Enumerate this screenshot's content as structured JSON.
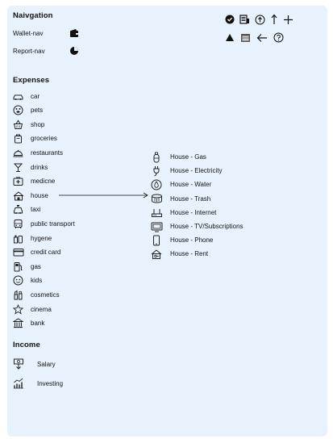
{
  "navigation": {
    "title": "Naivgation",
    "items": [
      {
        "label": "Wallet-nav",
        "icon": "wallet-icon"
      },
      {
        "label": "Report-nav",
        "icon": "pie-chart-icon"
      }
    ]
  },
  "toolbar": {
    "row1": [
      "check-circle-icon",
      "receipt-icon",
      "upload-circle-icon",
      "arrow-up-icon",
      "plus-icon"
    ],
    "row2": [
      "triangle-icon",
      "calendar-icon",
      "arrow-left-icon",
      "help-circle-icon"
    ]
  },
  "expenses": {
    "title": "Expenses",
    "items": [
      {
        "label": "car",
        "icon": "car-icon"
      },
      {
        "label": "pets",
        "icon": "paw-icon"
      },
      {
        "label": "shop",
        "icon": "basket-icon"
      },
      {
        "label": "groceries",
        "icon": "grocery-bag-icon"
      },
      {
        "label": "restaurants",
        "icon": "cloche-icon"
      },
      {
        "label": "drinks",
        "icon": "cocktail-icon"
      },
      {
        "label": "medicne",
        "icon": "medical-kit-icon"
      },
      {
        "label": "house",
        "icon": "house-icon"
      },
      {
        "label": "taxi",
        "icon": "taxi-icon"
      },
      {
        "label": "public transport",
        "icon": "bus-icon"
      },
      {
        "label": "hygene",
        "icon": "toiletries-icon"
      },
      {
        "label": "credit card",
        "icon": "credit-card-icon"
      },
      {
        "label": "gas",
        "icon": "fuel-icon"
      },
      {
        "label": "kids",
        "icon": "child-icon"
      },
      {
        "label": "cosmetics",
        "icon": "lipstick-icon"
      },
      {
        "label": "cinema",
        "icon": "star-icon"
      },
      {
        "label": "bank",
        "icon": "bank-icon"
      }
    ]
  },
  "house_subcategories": {
    "items": [
      {
        "label": "House - Gas",
        "icon": "gas-cylinder-icon"
      },
      {
        "label": "House - Electricity",
        "icon": "plug-icon"
      },
      {
        "label": "House - Water",
        "icon": "water-drop-icon"
      },
      {
        "label": "House - Trash",
        "icon": "trash-bin-icon"
      },
      {
        "label": "House - Internet",
        "icon": "router-icon"
      },
      {
        "label": "House - TV/Subscriptions",
        "icon": "tv-icon"
      },
      {
        "label": "House - Phone",
        "icon": "phone-icon"
      },
      {
        "label": "House - Rent",
        "icon": "house-key-icon"
      }
    ]
  },
  "income": {
    "title": "Income",
    "items": [
      {
        "label": "Salary",
        "icon": "money-hand-icon"
      },
      {
        "label": "Investing",
        "icon": "growth-chart-icon"
      }
    ]
  }
}
